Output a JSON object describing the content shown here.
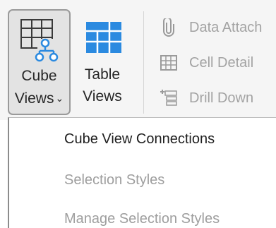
{
  "ribbon": {
    "cube_views": {
      "label_line1": "Cube",
      "label_line2": "Views",
      "dropdown_glyph": "⌄",
      "icon": "cube-views-icon"
    },
    "table_views": {
      "label_line1": "Table",
      "label_line2": "Views",
      "icon": "table-views-icon"
    },
    "small_buttons": [
      {
        "label": "Data Attach",
        "icon": "paperclip-icon",
        "enabled": false
      },
      {
        "label": "Cell Detail",
        "icon": "cell-detail-icon",
        "enabled": false
      },
      {
        "label": "Drill Down",
        "icon": "drill-down-icon",
        "enabled": false
      }
    ]
  },
  "menu": {
    "items": [
      {
        "label": "Cube View Connections",
        "enabled": true
      },
      {
        "label": "Selection Styles",
        "enabled": false
      },
      {
        "label": "Manage Selection Styles",
        "enabled": false
      }
    ]
  },
  "colors": {
    "accent_blue": "#2b8ae0",
    "pressed_bg": "#e3e3e3",
    "disabled_text": "#a3a3a3"
  }
}
